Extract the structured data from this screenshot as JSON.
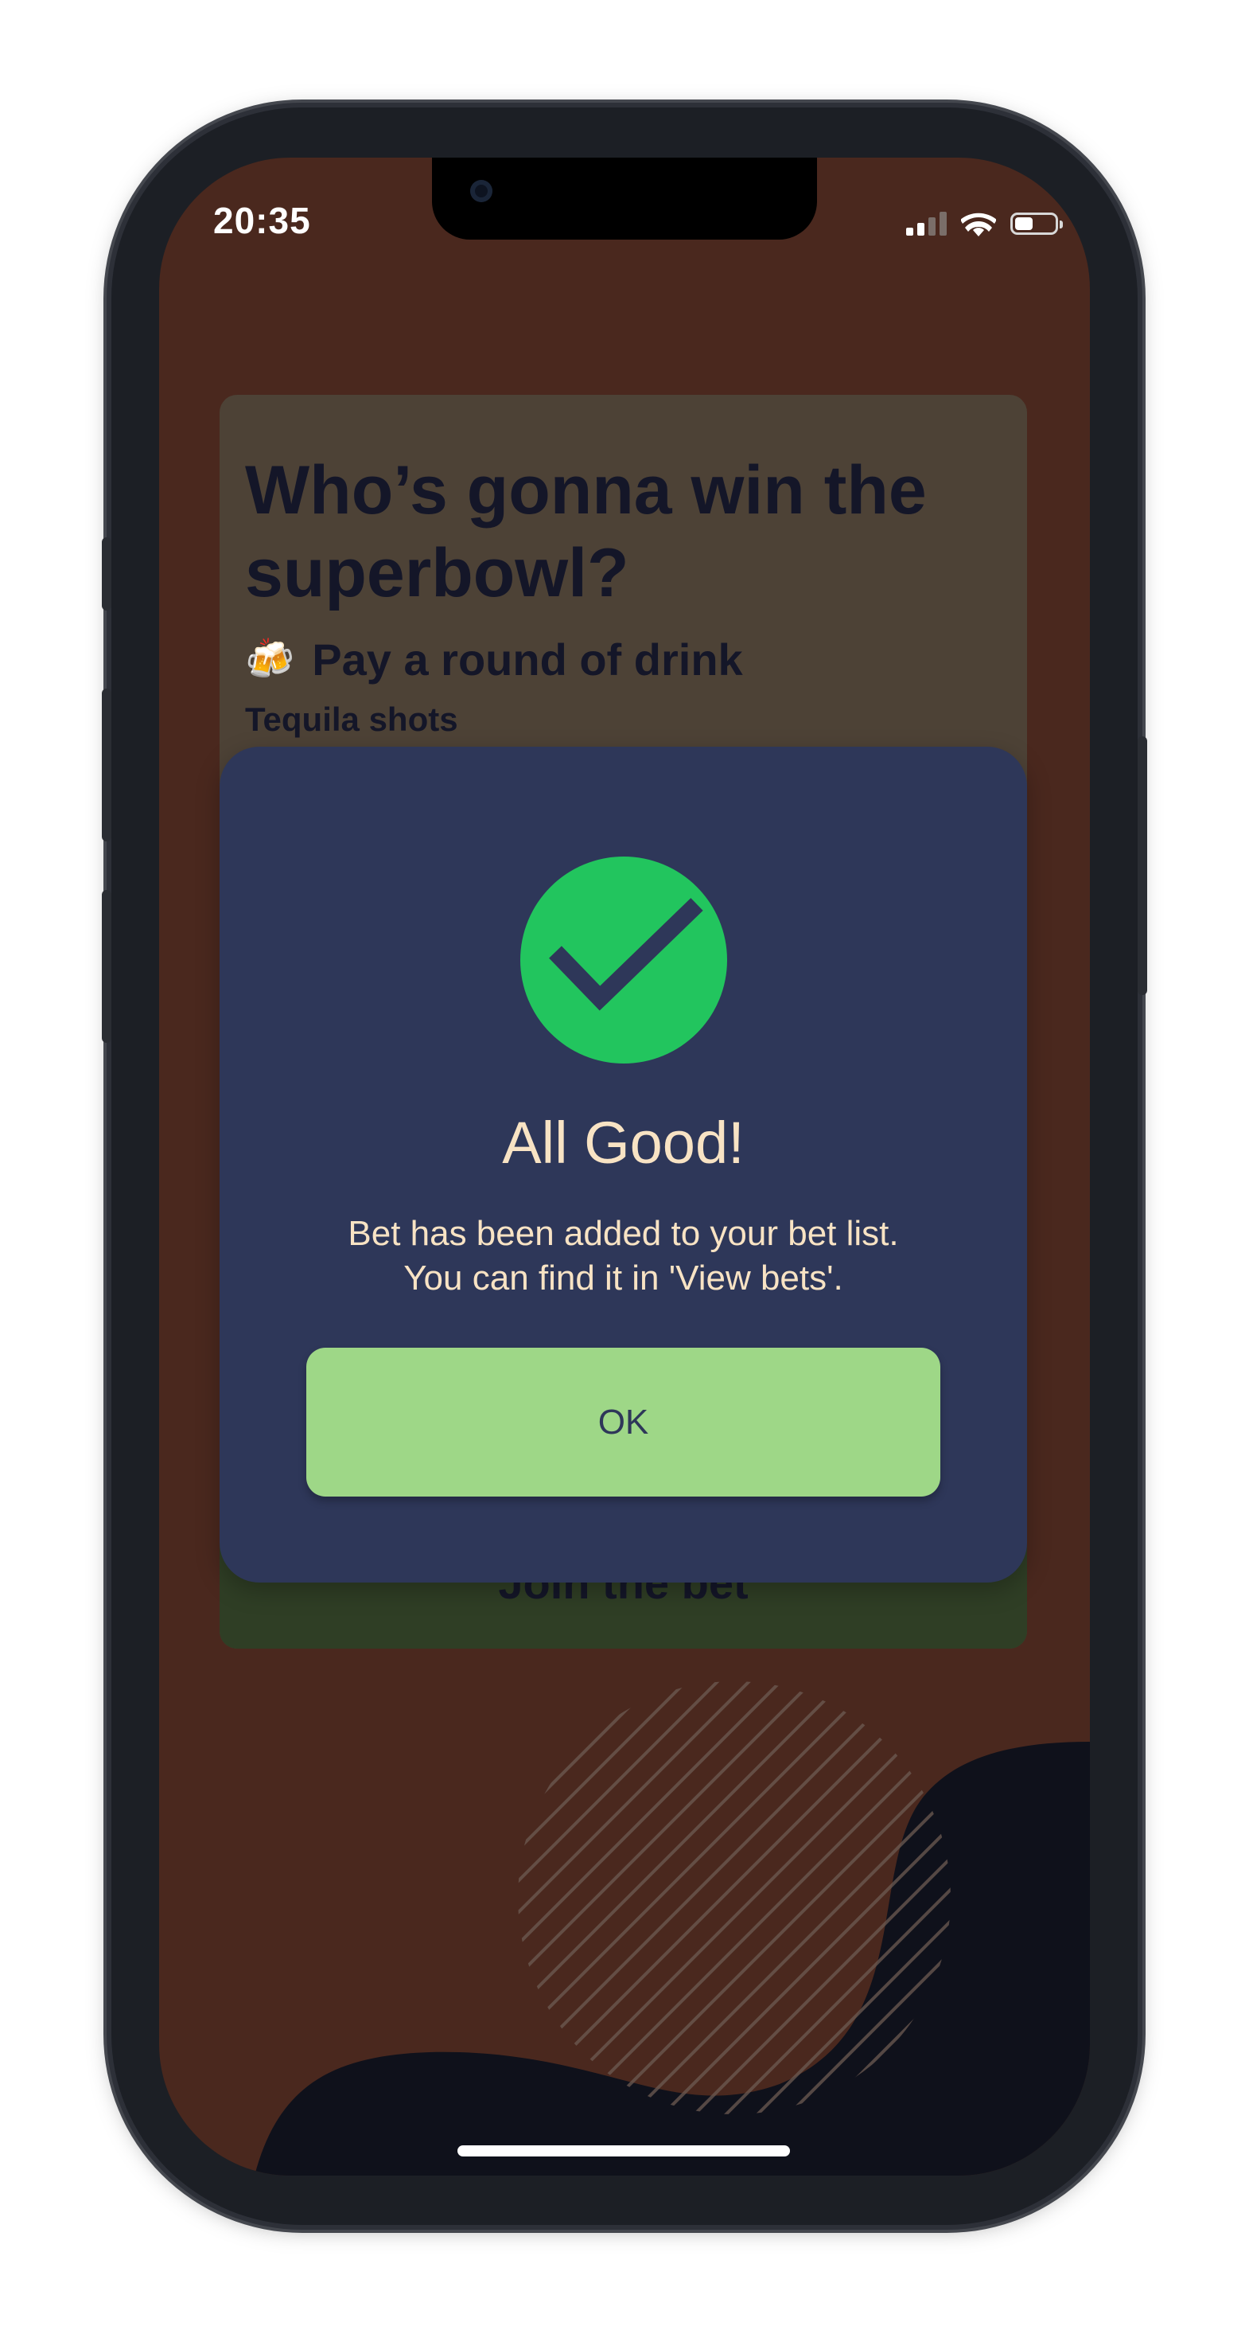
{
  "status_bar": {
    "time": "20:35"
  },
  "bet_card": {
    "title": "Who’s gonna win the superbowl?",
    "stake_icon": "beer-mugs-icon",
    "stake": "Pay a round of drink",
    "stake_detail": "Tequila shots",
    "join_button_label": "Join the bet"
  },
  "modal": {
    "icon": "check-circle-icon",
    "title": "All Good!",
    "message": "Bet has been added to your bet list.\nYou can find it in 'View bets'.",
    "ok_label": "OK"
  },
  "colors": {
    "screen_bg": "#4a281e",
    "modal_bg": "#2e3759",
    "success": "#22c55e",
    "ok_button": "#9ed787",
    "modal_text": "#f8e3c4"
  }
}
